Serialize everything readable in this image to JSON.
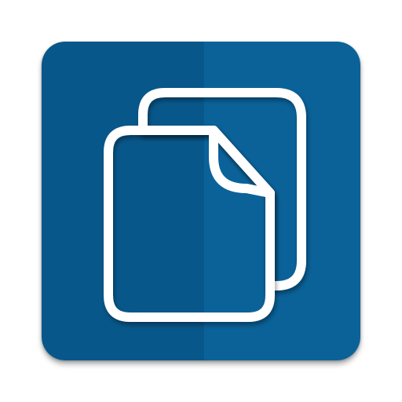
{
  "app_icon": {
    "glyph": "copy-documents-icon",
    "colors": {
      "tile_dark": "#08578a",
      "tile_light": "#0a6299",
      "outline": "#ffffff"
    }
  }
}
